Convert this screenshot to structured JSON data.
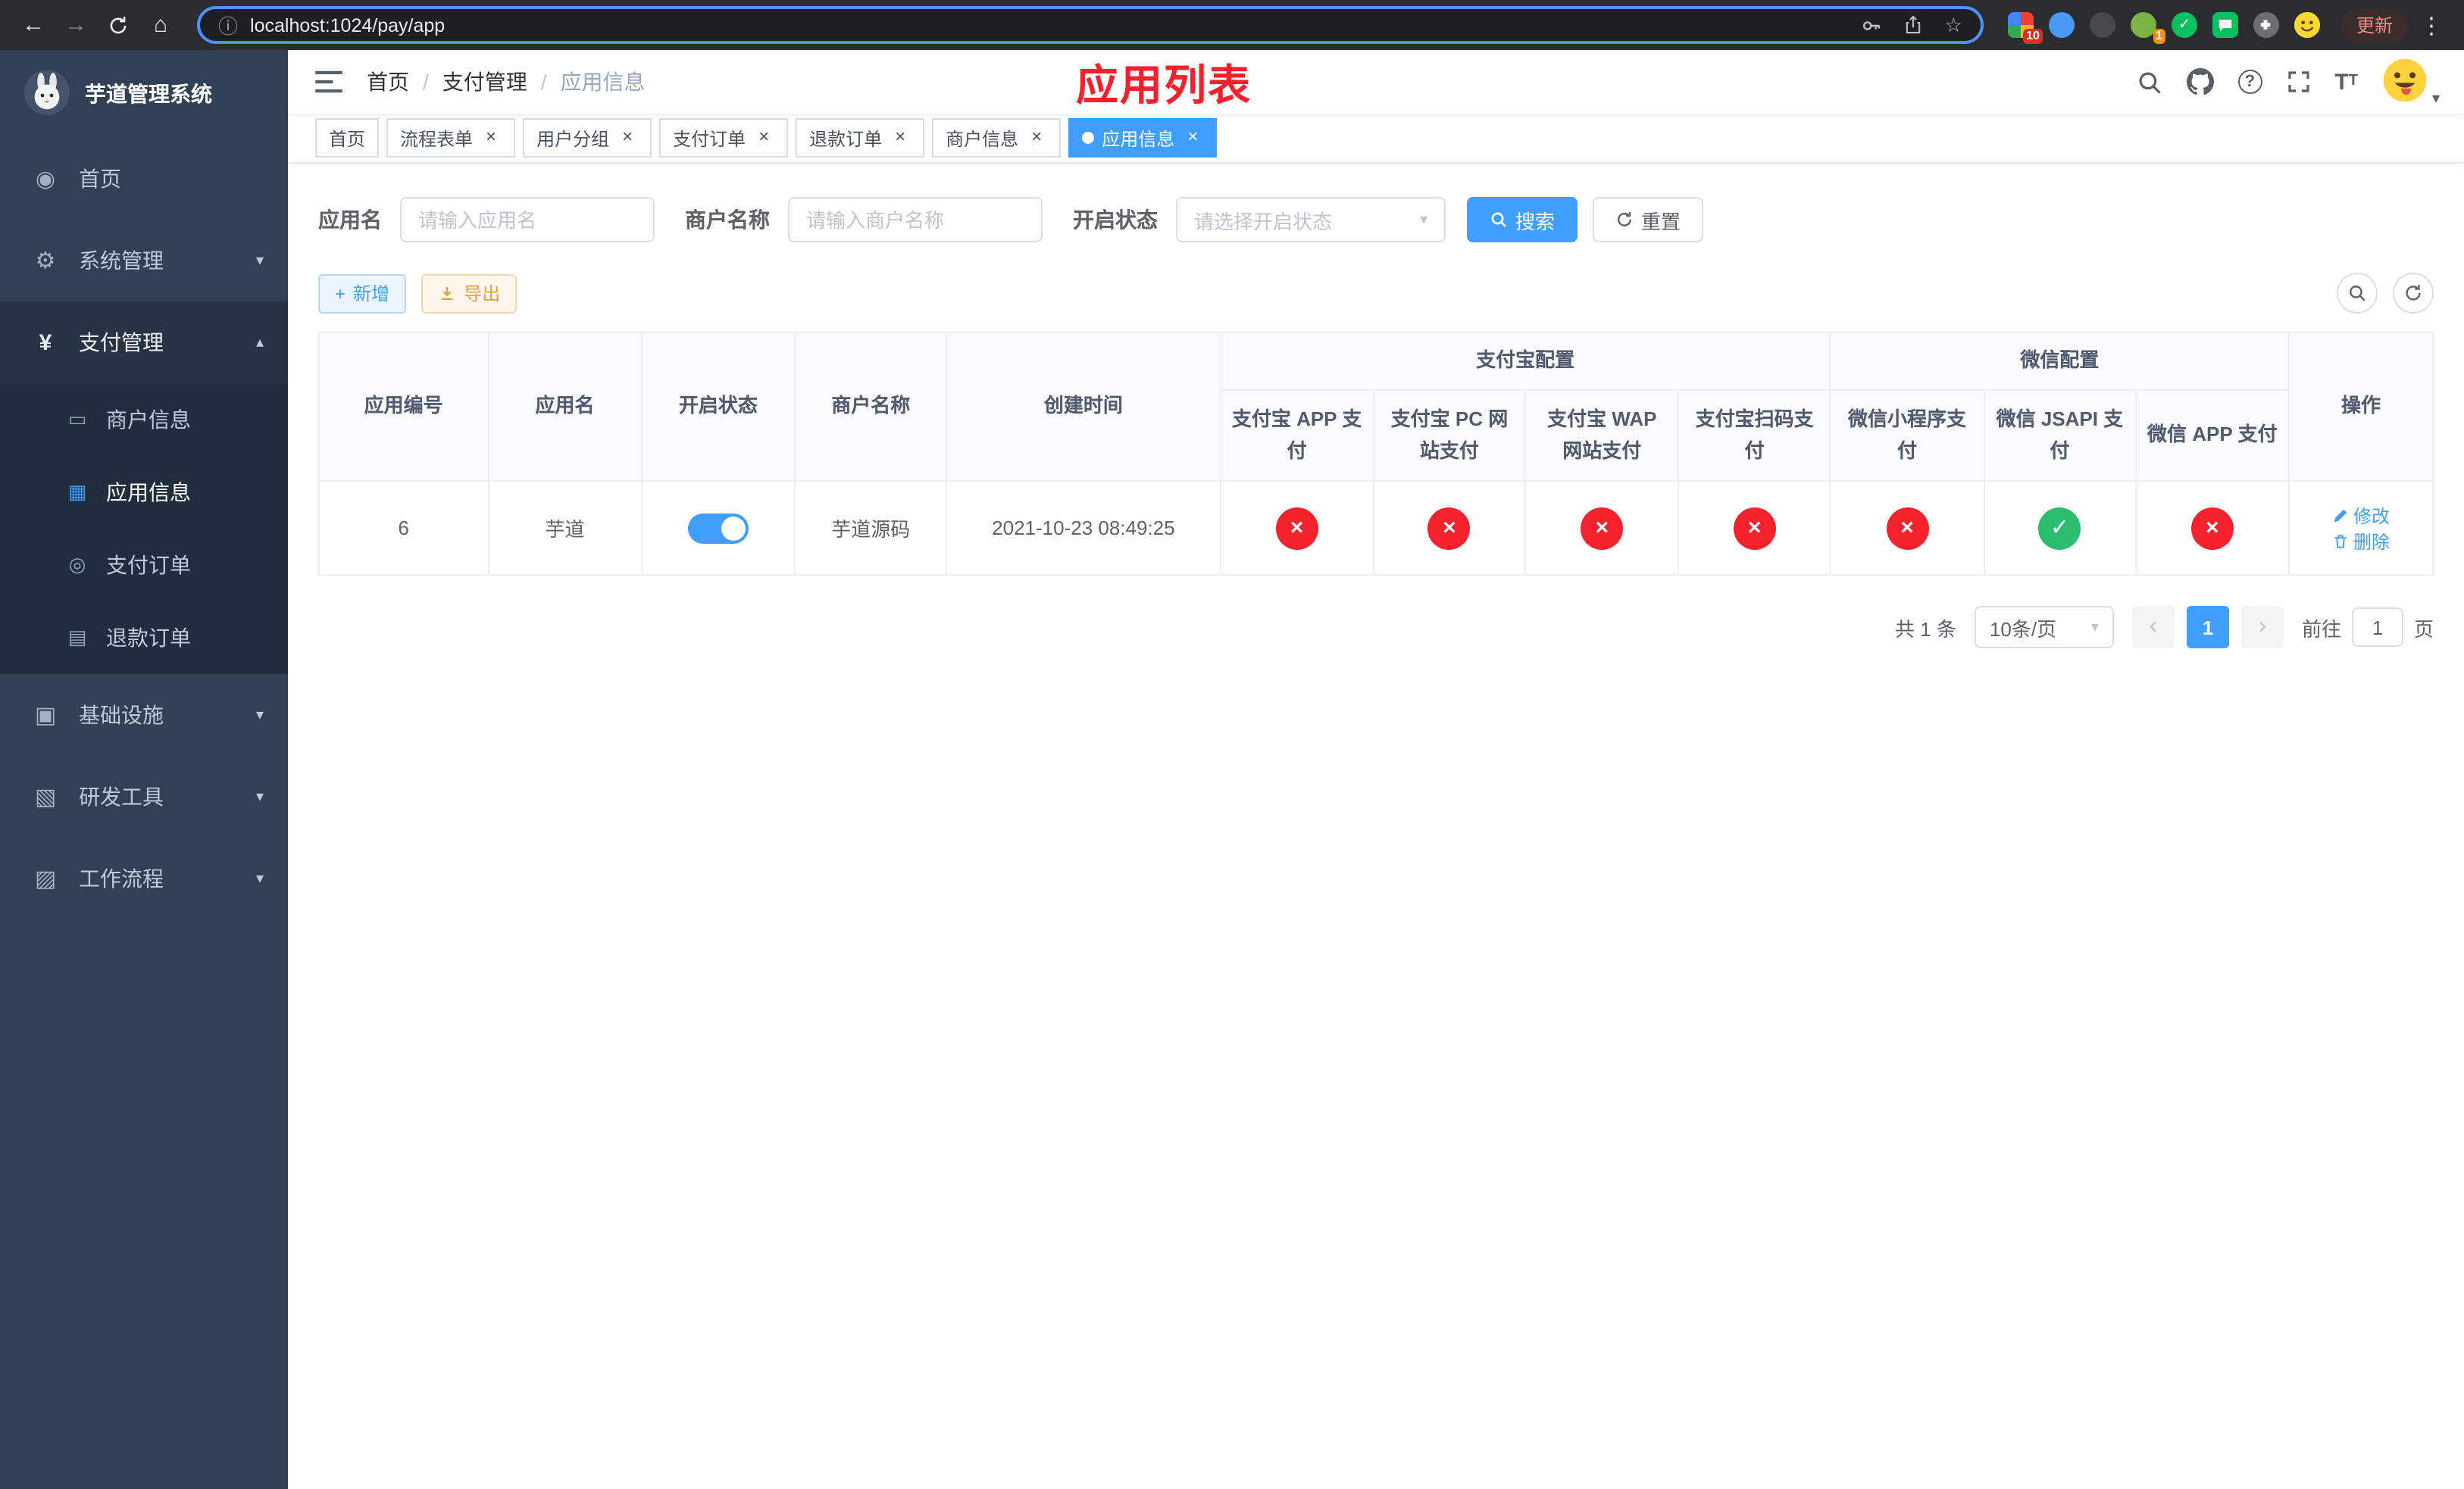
{
  "colors": {
    "primary": "#409eff",
    "success": "#2dbd6e",
    "danger": "#f5222d",
    "warning": "#e6a23c",
    "sidebar_bg": "#304156",
    "banner_red": "#f5222d"
  },
  "icons": {
    "home": "◉",
    "system": "⚙",
    "payment": "¥",
    "merchant": "▭",
    "app": "▦",
    "order": "◎",
    "refund": "▤",
    "infra": "▣",
    "devtools": "▧",
    "workflow": "▨",
    "chevron_down": "▾",
    "chevron_up": "▴",
    "caret_down": "▾",
    "dot": "●",
    "close": "×",
    "back": "←",
    "forward": "→",
    "browser_home": "⌂",
    "menu_dots": "⋮",
    "star": "☆",
    "info": "ⓘ",
    "prev": "‹",
    "next": "›",
    "question": "?",
    "plus": "+"
  },
  "browser": {
    "url": "localhost:1024/pay/app",
    "update_button": "更新",
    "ext_badges": [
      "10",
      "1"
    ]
  },
  "sidebar": {
    "app_title": "芋道管理系统",
    "items": [
      {
        "label": "首页"
      },
      {
        "label": "系统管理"
      },
      {
        "label": "支付管理"
      },
      {
        "label": "基础设施"
      },
      {
        "label": "研发工具"
      },
      {
        "label": "工作流程"
      }
    ],
    "sub": [
      {
        "label": "商户信息"
      },
      {
        "label": "应用信息"
      },
      {
        "label": "支付订单"
      },
      {
        "label": "退款订单"
      }
    ]
  },
  "header": {
    "breadcrumb": [
      "首页",
      "支付管理",
      "应用信息"
    ],
    "banner": "应用列表"
  },
  "tabs": [
    {
      "label": "首页"
    },
    {
      "label": "流程表单"
    },
    {
      "label": "用户分组"
    },
    {
      "label": "支付订单"
    },
    {
      "label": "退款订单"
    },
    {
      "label": "商户信息"
    },
    {
      "label": "应用信息"
    }
  ],
  "filters": {
    "app_name_label": "应用名",
    "app_name_placeholder": "请输入应用名",
    "merchant_label": "商户名称",
    "merchant_placeholder": "请输入商户名称",
    "status_label": "开启状态",
    "status_placeholder": "请选择开启状态",
    "search_label": "搜索",
    "reset_label": "重置"
  },
  "toolbar": {
    "add_label": "新增",
    "export_label": "导出"
  },
  "table": {
    "groups": {
      "alipay": "支付宝配置",
      "wechat": "微信配置"
    },
    "columns": {
      "id": "应用编号",
      "name": "应用名",
      "status": "开启状态",
      "merchant": "商户名称",
      "created": "创建时间",
      "alipay_app": "支付宝 APP 支付",
      "alipay_pc": "支付宝 PC 网站支付",
      "alipay_wap": "支付宝 WAP 网站支付",
      "alipay_qr": "支付宝扫码支付",
      "wx_lite": "微信小程序支付",
      "wx_jsapi": "微信 JSAPI 支付",
      "wx_app": "微信 APP 支付",
      "actions": "操作"
    },
    "rows": [
      {
        "id": "6",
        "name": "芋道",
        "enabled": true,
        "merchant": "芋道源码",
        "created": "2021-10-23 08:49:25",
        "configs": [
          false,
          false,
          false,
          false,
          false,
          true,
          false
        ],
        "edit": "修改",
        "delete": "删除"
      }
    ]
  },
  "pagination": {
    "total": "共 1 条",
    "page_size": "10条/页",
    "page": "1",
    "goto_label": "前往",
    "goto_value": "1",
    "page_unit": "页"
  }
}
